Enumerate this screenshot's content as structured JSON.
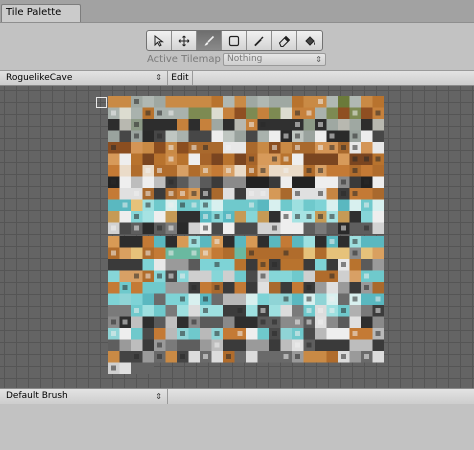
{
  "window": {
    "tab_title": "Tile Palette"
  },
  "toolbar": {
    "tools": [
      {
        "icon": "select-arrow-icon",
        "active": false
      },
      {
        "icon": "move-icon",
        "active": false
      },
      {
        "icon": "paint-brush-icon",
        "active": true
      },
      {
        "icon": "box-fill-icon",
        "active": false
      },
      {
        "icon": "eyedropper-icon",
        "active": false
      },
      {
        "icon": "eraser-icon",
        "active": false
      },
      {
        "icon": "flood-fill-icon",
        "active": false
      }
    ],
    "active_tilemap_label": "Active Tilemap",
    "active_tilemap_value": "Nothing"
  },
  "palette": {
    "selected": "RoguelikeCave",
    "edit_label": "Edit"
  },
  "brush": {
    "selected": "Default Brush"
  },
  "colors": {
    "grid_bg": "#646464",
    "grid_line": "#555555",
    "active_tool": "#7a7a7a"
  }
}
